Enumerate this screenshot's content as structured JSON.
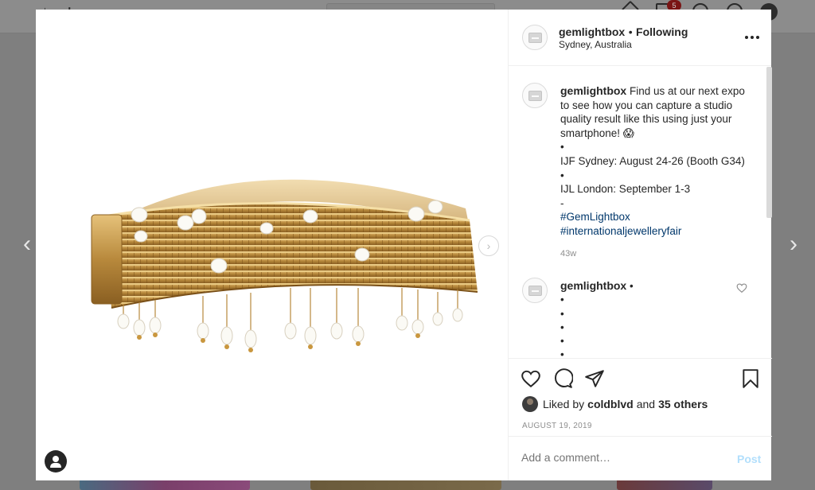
{
  "post": {
    "username": "gemlightbox",
    "separator": "•",
    "follow_status": "Following",
    "location": "Sydney, Australia"
  },
  "caption": {
    "username": "gemlightbox",
    "line1": "Find us at our next expo",
    "line2": "to see how you can capture a studio",
    "line3": "quality result like this using just your",
    "line4": "smartphone! 😱",
    "line5": "•",
    "line6": "IJF Sydney: August 24-26 (Booth G34)",
    "line7": "•",
    "line8": "IJL London: September 1-3",
    "line9": "-",
    "hashtag1": "#GemLightbox",
    "hashtag2": "#internationaljewelleryfair",
    "time_ago": "43w"
  },
  "reply": {
    "username": "gemlightbox",
    "separator": "•",
    "bullet": "•"
  },
  "likes": {
    "prefix": "Liked by",
    "liker": "coldblvd",
    "joiner": "and",
    "others": "35 others"
  },
  "date": "AUGUST 19, 2019",
  "comment": {
    "placeholder": "Add a comment…",
    "post_label": "Post"
  },
  "icons": {
    "prev": "chevron-left-icon",
    "next": "chevron-right-icon",
    "more": "more-horizontal-icon",
    "like": "heart-icon",
    "comment": "comment-bubble-icon",
    "share": "paper-plane-icon",
    "save": "bookmark-icon",
    "tag": "user-tag-icon"
  },
  "colors": {
    "hashtag": "#00376b",
    "post_button_disabled": "#b2dffc",
    "muted": "#8e8e8e",
    "overlay": "#7f7f7f"
  }
}
